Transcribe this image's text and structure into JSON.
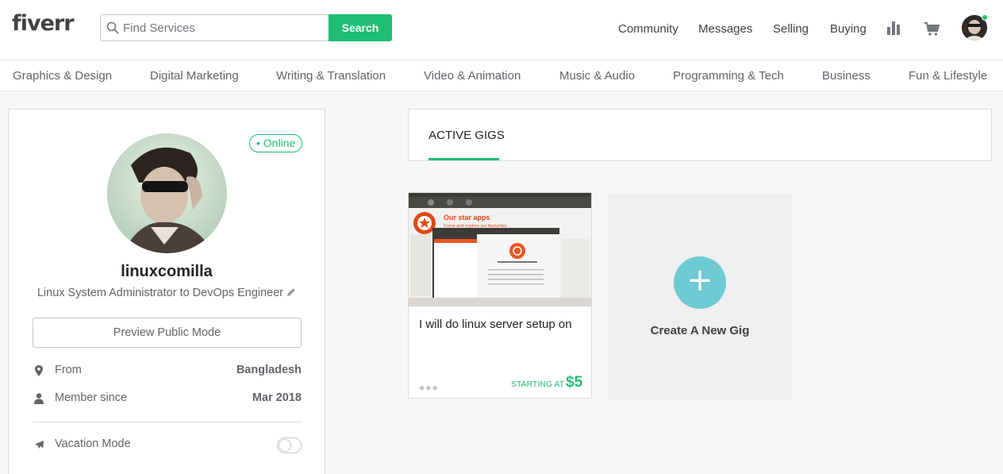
{
  "header": {
    "logo": "fiverr",
    "search": {
      "placeholder": "Find Services",
      "button_label": "Search"
    },
    "nav": [
      "Community",
      "Messages",
      "Selling",
      "Buying"
    ],
    "icons": [
      "analytics-bar-icon",
      "cart-icon",
      "user-avatar"
    ],
    "accent_color": "#1dbf73"
  },
  "categories": [
    "Graphics & Design",
    "Digital Marketing",
    "Writing & Translation",
    "Video & Animation",
    "Music & Audio",
    "Programming & Tech",
    "Business",
    "Fun & Lifestyle"
  ],
  "profile": {
    "status": "• Online",
    "username": "linuxcomilla",
    "tagline": "Linux System Administrator to DevOps Engineer",
    "preview_button": "Preview Public Mode",
    "from_label": "From",
    "from_value": "Bangladesh",
    "member_label": "Member since",
    "member_value": "Mar 2018",
    "vacation_label": "Vacation Mode",
    "vacation_on": false
  },
  "gigs": {
    "tab_label": "ACTIVE GIGS",
    "items": [
      {
        "title": "I will do linux server setup on",
        "starting_label": "STARTING AT",
        "price": "$5",
        "thumb_heading": "Our star apps",
        "thumb_sub": "Come and explore our favourites"
      }
    ],
    "create_label": "Create A New Gig",
    "create_color": "#6ecad3"
  }
}
